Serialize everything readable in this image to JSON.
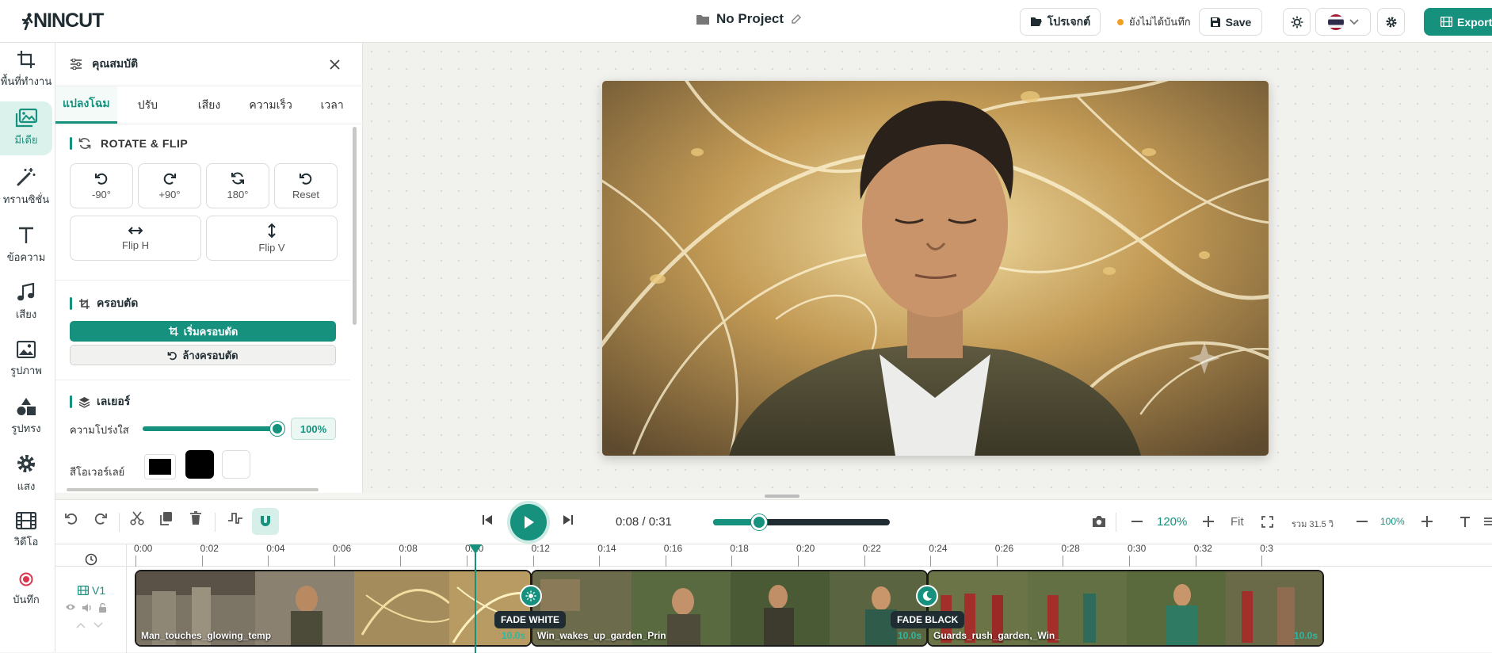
{
  "app": {
    "logo": "NINCUT",
    "project_title": "No Project"
  },
  "topbar": {
    "projects_label": "โปรเจกต์",
    "unsaved_label": "ยังไม่ได้บันทึก",
    "save_label": "Save",
    "export_label": "Export"
  },
  "rail": [
    {
      "label": "พื้นที่ทำงาน",
      "icon": "crop-icon"
    },
    {
      "label": "มีเดีย",
      "icon": "media-icon",
      "active": true
    },
    {
      "label": "ทรานซิชั่น",
      "icon": "magic-wand-icon"
    },
    {
      "label": "ข้อความ",
      "icon": "text-icon"
    },
    {
      "label": "เสียง",
      "icon": "music-icon"
    },
    {
      "label": "รูปภาพ",
      "icon": "image-icon"
    },
    {
      "label": "รูปทรง",
      "icon": "shapes-icon"
    },
    {
      "label": "แสง",
      "icon": "gear-icon"
    },
    {
      "label": "วิดีโอ",
      "icon": "film-icon"
    },
    {
      "label": "บันทึก",
      "icon": "record-icon"
    }
  ],
  "props": {
    "title": "คุณสมบัติ",
    "tabs": [
      "แปลงโฉม",
      "ปรับ",
      "เสียง",
      "ความเร็ว",
      "เวลา"
    ],
    "rotate_title": "ROTATE & FLIP",
    "rotate_buttons": [
      "-90°",
      "+90°",
      "180°",
      "Reset"
    ],
    "flip_buttons": [
      "Flip H",
      "Flip V"
    ],
    "crop_title": "ครอบตัด",
    "crop_start": "เริ่มครอบตัด",
    "crop_clear": "ล้างครอบตัด",
    "layer_title": "เลเยอร์",
    "opacity_label": "ความโปร่งใส",
    "opacity_value": "100%",
    "opacity": 1.0,
    "overlay_label": "สีโอเวอร์เลย์",
    "overlay_colors": [
      "#000000",
      "#000000",
      "#ffffff"
    ]
  },
  "playback": {
    "time": "0:08 / 0:31",
    "progress": 0.26,
    "zoom": "120%",
    "fit": "Fit",
    "total": "รวม 31.5 วิ",
    "zoom2": "100%"
  },
  "timeline": {
    "ticks": [
      "0:00",
      "0:02",
      "0:04",
      "0:06",
      "0:08",
      "0:10",
      "0:12",
      "0:14",
      "0:16",
      "0:18",
      "0:20",
      "0:22",
      "0:24",
      "0:26",
      "0:28",
      "0:30",
      "0:32",
      "0:3"
    ],
    "track": "V1",
    "clips": [
      {
        "name": "Man_touches_glowing_temp",
        "duration": "10.0s"
      },
      {
        "name": "Win_wakes_up_garden_Prin",
        "duration": "10.0s"
      },
      {
        "name": "Guards_rush_garden,_Win_",
        "duration": "10.0s"
      }
    ],
    "transitions": [
      "FADE WHITE",
      "FADE BLACK"
    ]
  },
  "colors": {
    "accent": "#16917e"
  }
}
